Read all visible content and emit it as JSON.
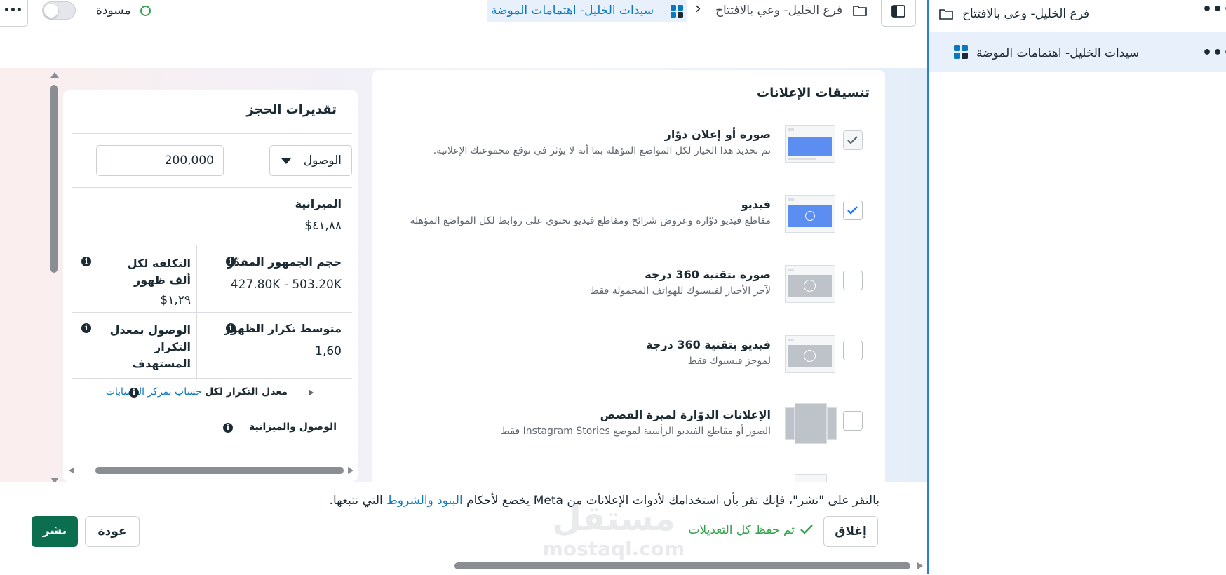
{
  "sidebar": {
    "items": [
      {
        "label": "فرع الخليل- وعي بالافتتاح",
        "icon": "folder-icon"
      },
      {
        "label": "سيدات الخليل- اهتمامات الموضة",
        "icon": "ad-set-grid-icon"
      }
    ],
    "more_label": "•••"
  },
  "topbar": {
    "more_label": "•••",
    "status": "مسودة",
    "breadcrumb_parent": "فرع الخليل- وعي بالافتتاح",
    "breadcrumb_current": "سيدات الخليل- اهتمامات الموضة",
    "separator": "›"
  },
  "formats": {
    "title": "تنسيقات الإعلانات",
    "items": [
      {
        "title": "صورة أو إعلان دوّار",
        "desc": "تم تحديد هذا الخيار لكل المواضع المؤهلة بما أنه لا يؤثر في توقع مجموعتك الإعلانية.",
        "checked": true,
        "locked": true,
        "thumb": "image-carousel-thumb"
      },
      {
        "title": "فيديو",
        "desc": "مقاطع فيديو دوّارة وعروض شرائح ومقاطع فيديو تحتوي على روابط لكل المواضع المؤهلة",
        "checked": true,
        "locked": false,
        "thumb": "video-thumb"
      },
      {
        "title": "صورة بتقنية 360 درجة",
        "desc": "لآخر الأخبار لفيسبوك للهواتف المحمولة فقط",
        "checked": false,
        "locked": false,
        "thumb": "photo-360-thumb"
      },
      {
        "title": "فيديو بتقنية 360 درجة",
        "desc": "لموجز فيسبوك فقط",
        "checked": false,
        "locked": false,
        "thumb": "video-360-thumb"
      },
      {
        "title": "الإعلانات الدوّارة لميزة القصص",
        "desc": "الصور أو مقاطع الفيديو الرأسية لموضع Instagram Stories فقط",
        "checked": false,
        "locked": false,
        "thumb": "stories-carousel-thumb"
      }
    ]
  },
  "estimates": {
    "title": "تقديرات الحجز",
    "metric_select": "الوصول",
    "reach_value": "200,000",
    "budget_label": "الميزانية",
    "budget_value": "٤١,٨٨$",
    "audience_label": "حجم الجمهور المقدّر",
    "audience_value": "427.80K - 503.20K",
    "cpm_label": "التكلفة لكل ألف ظهور",
    "cpm_value": "١,٢٩$",
    "frequency_label": "متوسط تكرار الظهور",
    "frequency_value": "1,60",
    "reach_at_freq_label": "الوصول بمعدل التكرار المستهدف",
    "reach_at_freq_value": "--",
    "freq_rate_prefix": "معدل التكرار لكل",
    "freq_rate_link": "حساب بمركز الحسابات",
    "reach_budget_label": "الوصول والميزانية"
  },
  "footer": {
    "terms_prefix": "بالنقر على \"نشر\"، فإنك تقر بأن استخدامك لأدوات الإعلانات من Meta يخضع لأحكام",
    "terms_link": "البنود والشروط",
    "terms_suffix": "التي نتبعها.",
    "saved_status": "تم حفظ كل التعديلات",
    "close_label": "إغلاق",
    "back_label": "عودة",
    "publish_label": "نشر"
  },
  "watermark": {
    "text": "مستقل",
    "url": "mostaql.com"
  },
  "colors": {
    "accent": "#0a78be",
    "publish": "#0b6e4f",
    "check": "#1877f2",
    "saved": "#31a24c"
  }
}
